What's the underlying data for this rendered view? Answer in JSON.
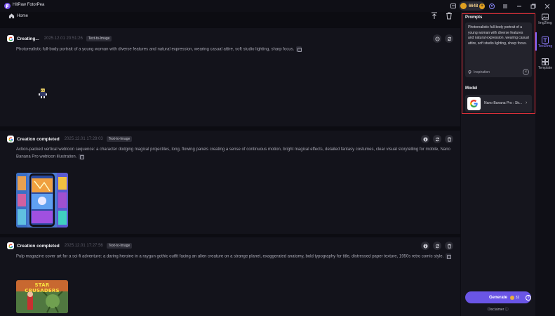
{
  "app": {
    "title": "HitPaw FotorPea"
  },
  "titlebar": {
    "coins": "6648",
    "coin_plus": "+"
  },
  "header": {
    "home_label": "Home"
  },
  "cards": [
    {
      "title": "Creating...",
      "time": "2025.12.01  20:51:26",
      "tag": "Text-to-Image",
      "desc": "Photorealistic full-body portrait of a young woman with diverse features and natural expression, wearing casual attire, soft studio lighting, sharp focus."
    },
    {
      "title": "Creation completed",
      "time": "2025.12.01  17:28:03",
      "tag": "Text-to-Image",
      "desc": "Action-packed vertical webtoon sequence: a character dodging magical projectiles, long, flowing panels creating a sense of continuous motion, bright magical effects, detailed fantasy costumes, clear visual storytelling for mobile, Nano Banana Pro webtoon illustration."
    },
    {
      "title": "Creation completed",
      "time": "2025.12.01  17:27:56",
      "tag": "Text-to-Image",
      "desc": "Pulp magazine cover art for a sci-fi adventure: a daring heroine in a raygun gothic outfit facing an alien creature on a strange planet, exaggerated anatomy, bold typography for title, distressed paper texture, 1950s retro comic style.",
      "thumb_text": "STAR CRUSADERS"
    }
  ],
  "panel": {
    "prompts_label": "Prompts",
    "prompt_text": "Photorealistic full-body portrait of a young woman with diverse features and natural expression, wearing casual attire, soft studio lighting, sharp focus.",
    "inspiration_label": "Inspiration",
    "model_label": "Model",
    "model_name": "Nano Banana Pro : Str...",
    "generate_label": "Generate",
    "generate_cost": "32",
    "disclaimer": "Disclaimer"
  },
  "side_nav": [
    {
      "label": "Img2Img",
      "icon": "image-icon"
    },
    {
      "label": "Text2Img",
      "icon": "text-image-icon",
      "active": true
    },
    {
      "label": "Template",
      "icon": "template-icon"
    }
  ],
  "colors": {
    "accent": "#6a55e6",
    "highlight_frame": "#e0303a",
    "background": "#0c0c12"
  }
}
